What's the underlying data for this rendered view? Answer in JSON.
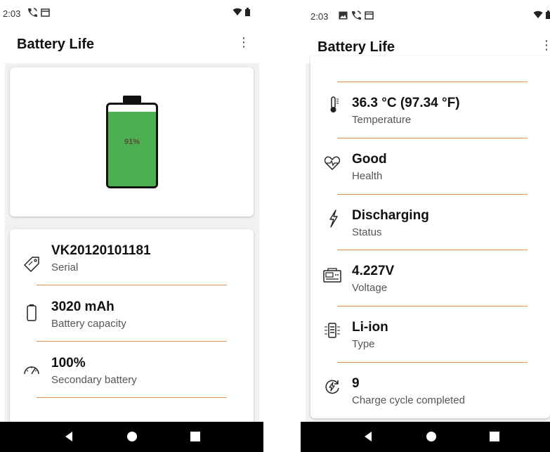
{
  "left": {
    "status": {
      "time": "2:03"
    },
    "appbar": {
      "title": "Battery Life"
    },
    "battery": {
      "percent_label": "91%",
      "level": 0.91,
      "fill_color": "#4cb050"
    },
    "items": [
      {
        "value": "VK20120101181",
        "label": "Serial",
        "icon": "tag-icon"
      },
      {
        "value": "3020 mAh",
        "label": "Battery capacity",
        "icon": "battery-outline-icon"
      },
      {
        "value": "100%",
        "label": "Secondary battery",
        "icon": "gauge-icon"
      }
    ]
  },
  "right": {
    "status": {
      "time": "2:03"
    },
    "appbar": {
      "title": "Battery Life"
    },
    "items": [
      {
        "value": "36.3 °C (97.34 °F)",
        "label": "Temperature",
        "icon": "thermometer-icon"
      },
      {
        "value": "Good",
        "label": "Health",
        "icon": "heart-pulse-icon"
      },
      {
        "value": "Discharging",
        "label": "Status",
        "icon": "lightning-icon"
      },
      {
        "value": "4.227V",
        "label": "Voltage",
        "icon": "voltmeter-icon"
      },
      {
        "value": "Li-ion",
        "label": "Type",
        "icon": "battery-chip-icon"
      },
      {
        "value": "9",
        "label": "Charge cycle completed",
        "icon": "cycle-icon"
      }
    ]
  },
  "colors": {
    "divider": "#e0904b",
    "battery_green": "#4cb050",
    "navbar": "#000000"
  }
}
